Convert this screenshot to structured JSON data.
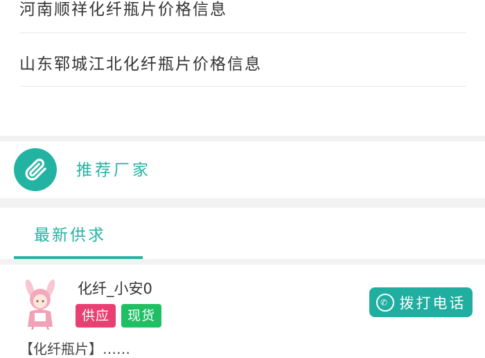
{
  "news": {
    "items": [
      {
        "title": "河南顺祥化纤瓶片价格信息"
      },
      {
        "title": "山东郓城江北化纤瓶片价格信息"
      }
    ]
  },
  "recommend": {
    "title": "推荐厂家",
    "icon": "paperclip-icon"
  },
  "tabs": {
    "active_label": "最新供求"
  },
  "post": {
    "username": "化纤_小安0",
    "tags": {
      "supply": "供应",
      "spot": "现货"
    },
    "call_button": "拨打电话",
    "call_icon": "phone-icon",
    "desc_preview": "【化纤瓶片】……"
  },
  "colors": {
    "accent": "#23b3a3",
    "supply_tag": "#ea3f72",
    "spot_tag": "#1fbf64",
    "call_button": "#1fae9f"
  }
}
